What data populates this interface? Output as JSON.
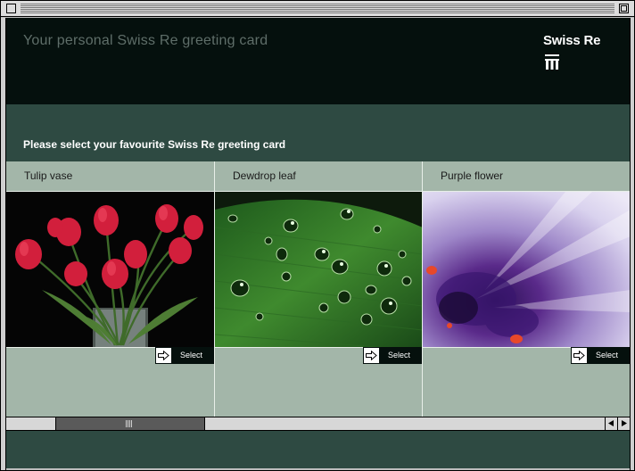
{
  "header": {
    "title": "Your personal Swiss Re greeting card",
    "logo_text": "Swiss Re"
  },
  "instruction": "Please select your favourite Swiss Re greeting card",
  "cards": [
    {
      "label": "Tulip vase",
      "select_label": "Select"
    },
    {
      "label": "Dewdrop leaf",
      "select_label": "Select"
    },
    {
      "label": "Purple flower",
      "select_label": "Select"
    }
  ],
  "colors": {
    "header_bg": "#05100d",
    "page_bg": "#2e4a42",
    "card_bg": "#a3b6a9",
    "button_bg": "#05100d"
  },
  "icons": {
    "select": "arrow-right-icon",
    "logo": "swiss-re-logo-mark",
    "scroll_left": "triangle-left-icon",
    "scroll_right": "triangle-right-icon"
  }
}
